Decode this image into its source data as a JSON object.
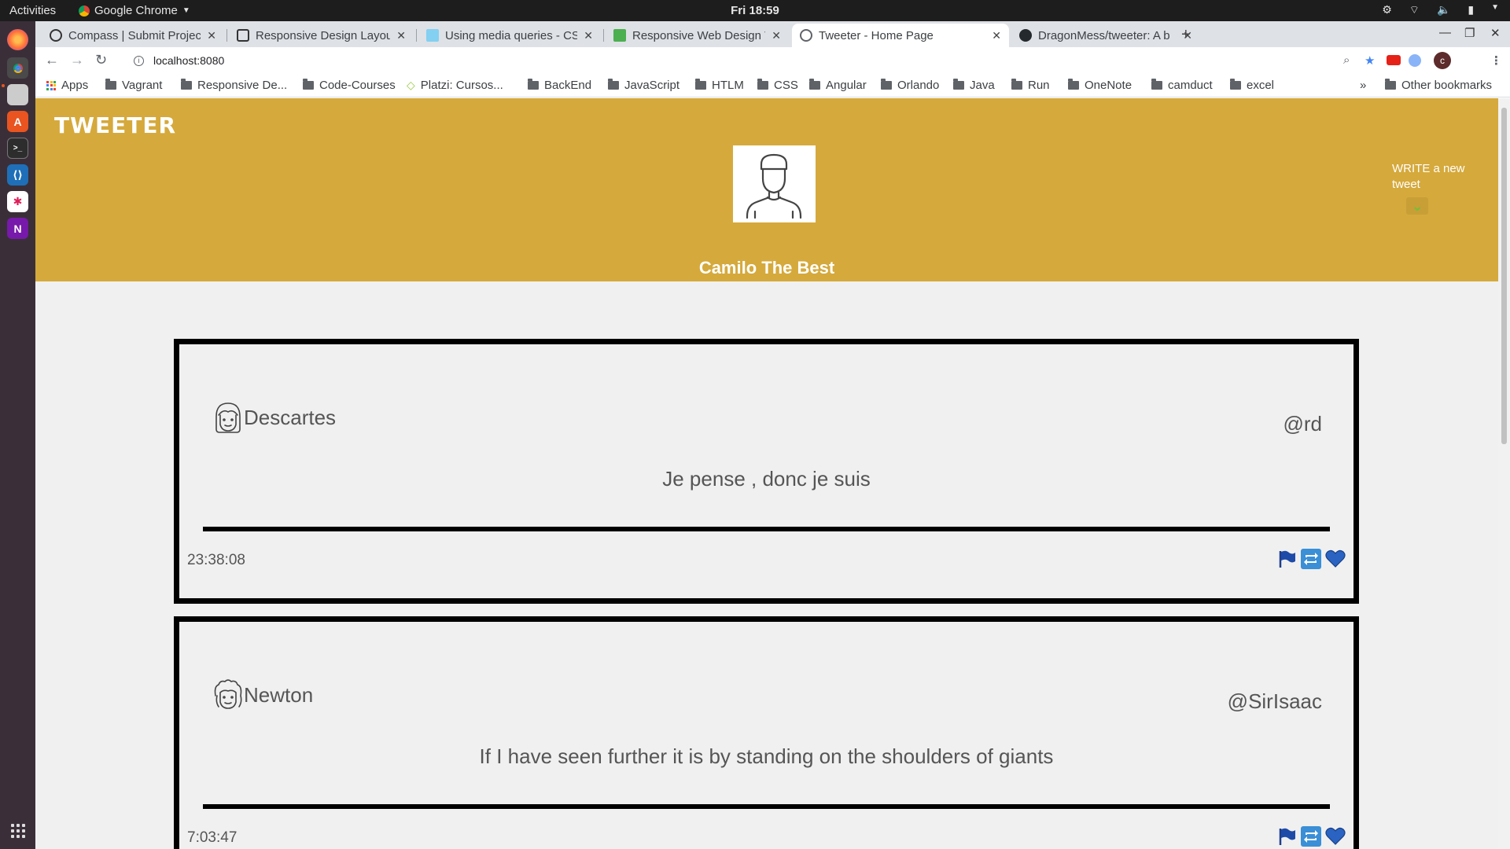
{
  "os": {
    "activities": "Activities",
    "app_name": "Google Chrome",
    "clock": "Fri 18:59"
  },
  "browser": {
    "tabs": [
      {
        "title": "Compass | Submit Project"
      },
      {
        "title": "Responsive Design Layout"
      },
      {
        "title": "Using media queries - CSS"
      },
      {
        "title": "Responsive Web Design V"
      },
      {
        "title": "Tweeter - Home Page"
      },
      {
        "title": "DragonMess/tweeter: A b"
      }
    ],
    "url": "localhost:8080",
    "profile_initial": "c",
    "bookmarks": [
      "Apps",
      "Vagrant",
      "Responsive De...",
      "Code-Courses",
      "Platzi: Cursos...",
      "BackEnd",
      "JavaScript",
      "HTLM",
      "CSS",
      "Angular",
      "Orlando",
      "Java",
      "Run",
      "OneNote",
      "camduct",
      "excel"
    ],
    "other_bookmarks": "Other bookmarks",
    "overflow": "»"
  },
  "page": {
    "logo": "TWEETER",
    "username": "Camilo The Best",
    "compose_label": "WRITE a new tweet",
    "header_color": "#d5a93b",
    "tweets": [
      {
        "name": "Descartes",
        "handle": "@rd",
        "text": "Je pense , donc je suis",
        "time": "23:38:08"
      },
      {
        "name": "Newton",
        "handle": "@SirIsaac",
        "text": "If I have seen further it is by standing on the shoulders of giants",
        "time": "7:03:47"
      }
    ]
  }
}
